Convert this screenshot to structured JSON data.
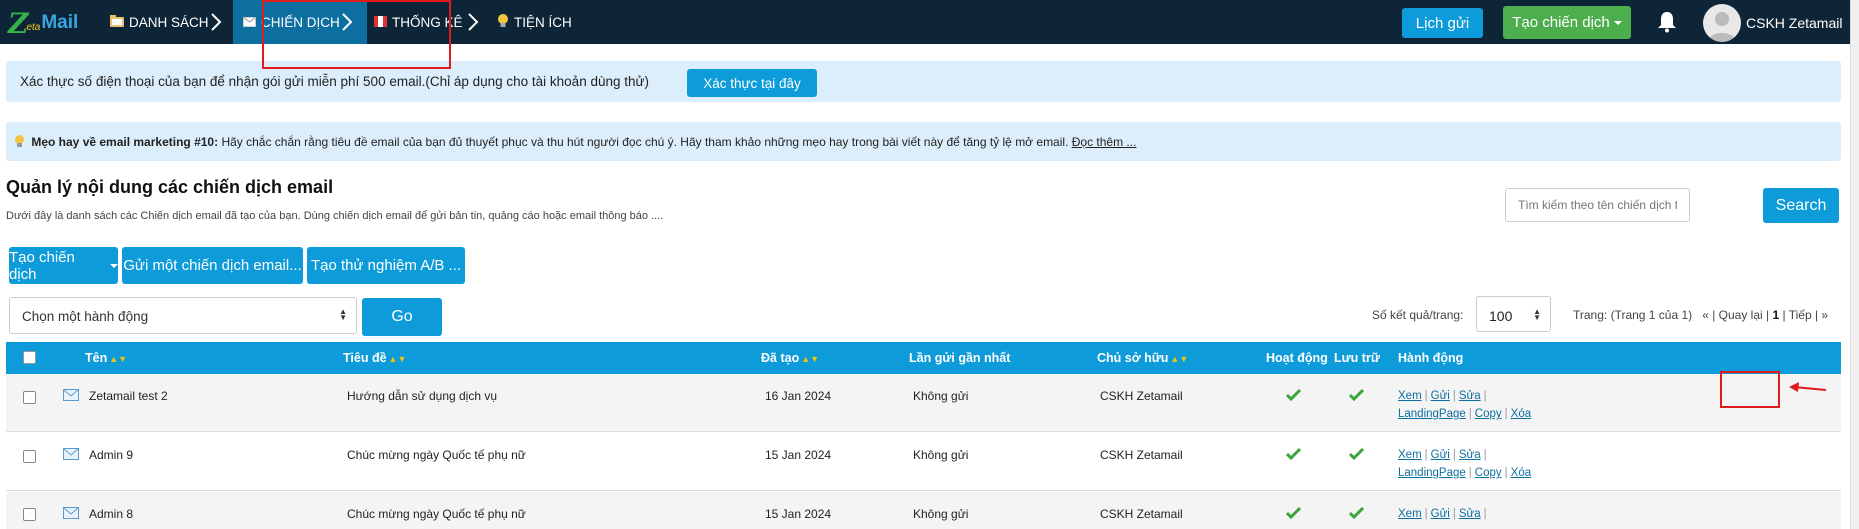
{
  "topnav": {
    "logo": {
      "z": "Z",
      "eta": "eta",
      "mail": "Mail"
    },
    "items": [
      {
        "label": "DANH SÁCH",
        "icon": "folder-icon"
      },
      {
        "label": "CHIẾN DỊCH",
        "icon": "envelope-icon"
      },
      {
        "label": "THỐNG KÊ",
        "icon": "flag-icon"
      },
      {
        "label": "TIỆN ÍCH",
        "icon": "lightbulb-icon"
      }
    ],
    "schedule_button": "Lịch gửi",
    "create_campaign_button": "Tạo chiến dịch",
    "user_name": "CSKH Zetamail",
    "colors": {
      "bar": "#0d2536",
      "active": "#0d6fa0",
      "primary": "#0d9bd9",
      "success": "#4cae4c"
    }
  },
  "notice_phone": {
    "text": "Xác thực số điện thoại của bạn để nhận gói gửi miễn phí 500 email.(Chỉ áp dụng cho tài khoản dùng thử)",
    "button": "Xác thực tại đây"
  },
  "notice_tip": {
    "title": "Mẹo hay về email marketing #10:",
    "text": "Hãy chắc chắn rằng tiêu đề email của bạn đủ thuyết phục và thu hút người đọc chú ý. Hãy tham khảo những mẹo hay trong bài viết này để tăng tỷ lệ mở email.",
    "link": "Đọc thêm ..."
  },
  "page": {
    "title": "Quản lý nội dung các chiến dịch email",
    "subtitle": "Dưới đây là danh sách các Chiến dịch email đã tạo của bạn. Dùng chiến dịch email để gửi bản tin, quảng cáo hoặc email thông báo ...."
  },
  "search": {
    "placeholder": "Tìm kiếm theo tên chiến dịch tại đây",
    "button": "Search"
  },
  "actions": {
    "create": "Tạo chiến dịch",
    "send": "Gửi một chiến dịch email...",
    "ab_test": "Tạo thử nghiệm A/B ...",
    "bulk_select": "Chọn một hành động",
    "go": "Go"
  },
  "pagination": {
    "per_page_label": "Số kết quả/trang:",
    "per_page_value": "100",
    "info": "Trang: (Trang 1 của 1)",
    "prev": "« | Quay lại |",
    "current": "1",
    "next": "| Tiếp | »"
  },
  "table": {
    "headers": {
      "name": "Tên",
      "subject": "Tiêu đề",
      "created": "Đã tạo",
      "last_sent": "Lần gửi gần nhất",
      "owner": "Chủ sở hữu",
      "active": "Hoạt động",
      "archive": "Lưu trữ",
      "actions": "Hành động"
    },
    "sort_marker": "▲▼",
    "rows": [
      {
        "name": "Zetamail test 2",
        "subject": "Hướng dẫn sử dụng dịch vụ",
        "created": "16 Jan 2024",
        "last_sent": "Không gửi",
        "owner": "CSKH Zetamail"
      },
      {
        "name": "Admin 9",
        "subject": "Chúc mừng ngày Quốc tế phụ nữ",
        "created": "15 Jan 2024",
        "last_sent": "Không gửi",
        "owner": "CSKH Zetamail"
      },
      {
        "name": "Admin 8",
        "subject": "Chúc mừng ngày Quốc tế phụ nữ",
        "created": "15 Jan 2024",
        "last_sent": "Không gửi",
        "owner": "CSKH Zetamail"
      }
    ],
    "row_actions": {
      "view": "Xem",
      "send": "Gửi",
      "edit": "Sửa",
      "landing": "LandingPage",
      "copy": "Copy",
      "delete": "Xóa",
      "sep": "|"
    }
  }
}
